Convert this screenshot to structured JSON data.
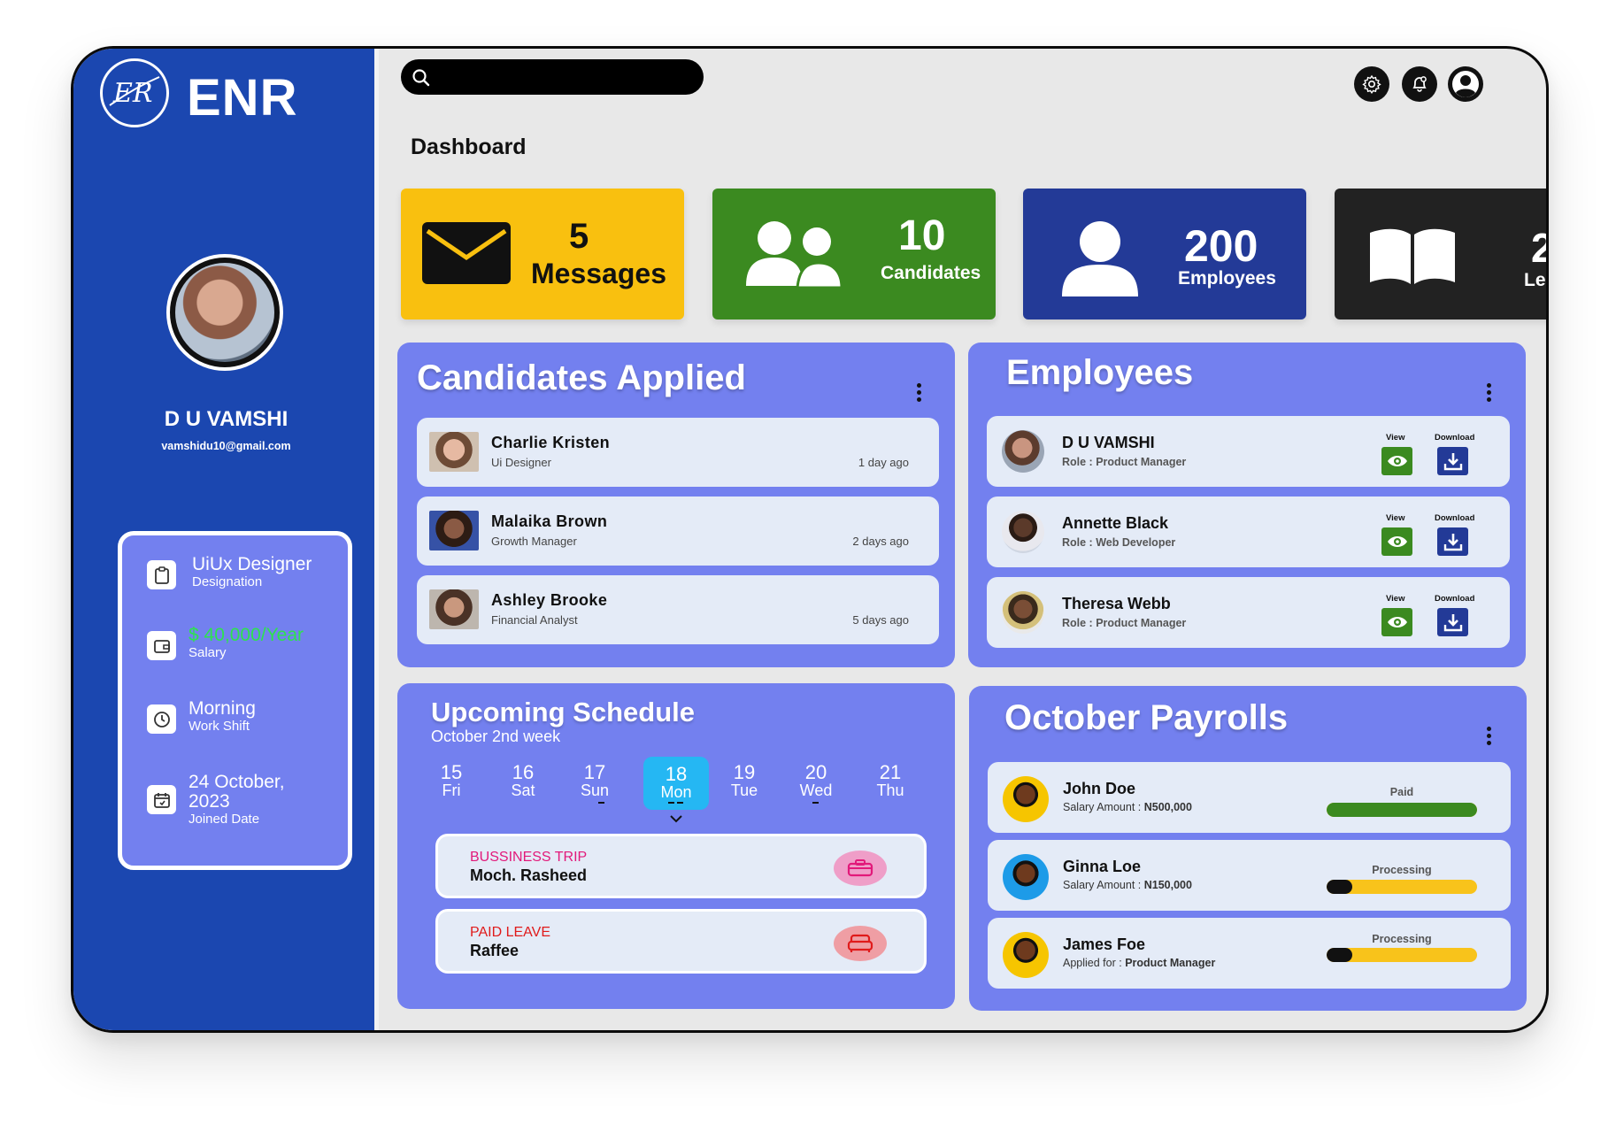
{
  "brand": {
    "name": "ENR"
  },
  "user": {
    "name": "D U VAMSHI",
    "email": "vamshidu10@gmail.com"
  },
  "profile_info": [
    {
      "value": "UiUx Designer",
      "label": "Designation",
      "icon": "clipboard-icon"
    },
    {
      "value": "$ 40,000/Year",
      "label": "Salary",
      "icon": "wallet-icon"
    },
    {
      "value": "Morning",
      "label": "Work Shift",
      "icon": "clock-icon"
    },
    {
      "value": "24 October, 2023",
      "label": "Joined Date",
      "icon": "calendar-icon"
    }
  ],
  "search": {
    "placeholder": ""
  },
  "page": {
    "title": "Dashboard"
  },
  "stats": [
    {
      "value": "5",
      "label": "Messages",
      "color": "#f9c00f",
      "icon": "envelope-icon"
    },
    {
      "value": "10",
      "label": "Candidates",
      "color": "#3b8a20",
      "icon": "users-icon"
    },
    {
      "value": "200",
      "label": "Employees",
      "color": "#233a97",
      "icon": "user-icon"
    },
    {
      "value": "2",
      "label": "Le",
      "color": "#222222",
      "icon": "book-icon"
    }
  ],
  "candidates": {
    "title": "Candidates Applied",
    "items": [
      {
        "name": "Charlie Kristen",
        "role": "Ui Designer",
        "time": "1 day ago"
      },
      {
        "name": "Malaika Brown",
        "role": "Growth Manager",
        "time": "2 days ago"
      },
      {
        "name": "Ashley Brooke",
        "role": "Financial Analyst",
        "time": "5 days ago"
      }
    ]
  },
  "employees": {
    "title": "Employees",
    "view_label": "View",
    "download_label": "Download",
    "items": [
      {
        "name": "D U VAMSHI",
        "role": "Role : Product Manager"
      },
      {
        "name": "Annette Black",
        "role": "Role : Web Developer"
      },
      {
        "name": "Theresa Webb",
        "role": "Role : Product Manager"
      }
    ]
  },
  "schedule": {
    "title": "Upcoming Schedule",
    "subtitle": "October 2nd week",
    "days": [
      {
        "date": "15",
        "weekday": "Fri"
      },
      {
        "date": "16",
        "weekday": "Sat"
      },
      {
        "date": "17",
        "weekday": "Sun"
      },
      {
        "date": "18",
        "weekday": "Mon"
      },
      {
        "date": "19",
        "weekday": "Tue"
      },
      {
        "date": "20",
        "weekday": "Wed"
      },
      {
        "date": "21",
        "weekday": "Thu"
      }
    ],
    "selected": "18",
    "events": [
      {
        "type": "BUSSINESS TRIP",
        "name": "Moch. Rasheed",
        "type_color": "#e2197a",
        "icon": "briefcase-icon"
      },
      {
        "type": "PAID LEAVE",
        "name": "Raffee",
        "type_color": "#e01b1b",
        "icon": "sofa-icon"
      }
    ]
  },
  "payrolls": {
    "title": "October Payrolls",
    "items": [
      {
        "name": "John Doe",
        "sub_label": "Salary Amount :",
        "sub_value": "N500,000",
        "status": "Paid",
        "progress": 1.0
      },
      {
        "name": "Ginna Loe",
        "sub_label": "Salary Amount :",
        "sub_value": "N150,000",
        "status": "Processing",
        "progress": 0.17
      },
      {
        "name": "James Foe",
        "sub_label": "Applied for :",
        "sub_value": "Product Manager",
        "status": "Processing",
        "progress": 0.17
      }
    ]
  }
}
